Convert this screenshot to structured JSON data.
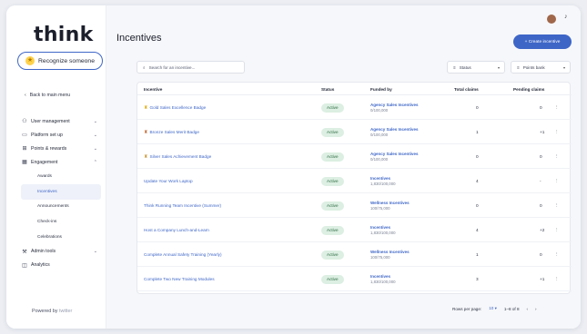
{
  "app": {
    "logo": "think",
    "page_title": "Incentives"
  },
  "sidebar": {
    "recognize_label": "Recognize someone",
    "back_label": "Back to main menu",
    "items": [
      {
        "label": "User management",
        "icon": "users-icon",
        "chevron": "v"
      },
      {
        "label": "Platform set up",
        "icon": "monitor-icon",
        "chevron": "v"
      },
      {
        "label": "Points & rewards",
        "icon": "gift-icon",
        "chevron": "v"
      },
      {
        "label": "Engagement",
        "icon": "calendar-icon",
        "chevron": "^"
      }
    ],
    "engagement_sub": [
      {
        "label": "Awards"
      },
      {
        "label": "Incentives"
      },
      {
        "label": "Announcements"
      },
      {
        "label": "Check-ins"
      },
      {
        "label": "Celebrations"
      }
    ],
    "items_after": [
      {
        "label": "Admin tools",
        "icon": "tools-icon",
        "chevron": "v"
      },
      {
        "label": "Analytics",
        "icon": "analytics-icon",
        "chevron": ""
      }
    ],
    "powered_by": "Powered by",
    "powered_brand": "twitter"
  },
  "header": {
    "create_label": "+ Create incentive"
  },
  "toolbar": {
    "search_placeholder": "Search for an incentive...",
    "status_filter": "Status",
    "points_filter": "Points bank"
  },
  "table": {
    "headers": [
      "Incentive",
      "Status",
      "Funded by",
      "Total claims",
      "Pending claims"
    ],
    "rows": [
      {
        "incentive": "Gold Sales Excellence Badge",
        "medal": "gold",
        "status": "Active",
        "fund_name": "Agency Sales Incentives",
        "fund_amount": "0/100,000",
        "total": "0",
        "pending": "0"
      },
      {
        "incentive": "Bronze Sales Merit Badge",
        "medal": "bronze",
        "status": "Active",
        "fund_name": "Agency Sales Incentives",
        "fund_amount": "0/100,000",
        "total": "1",
        "pending": "+1"
      },
      {
        "incentive": "Silver Sales Achievement Badge",
        "medal": "silver",
        "status": "Active",
        "fund_name": "Agency Sales Incentives",
        "fund_amount": "0/100,000",
        "total": "0",
        "pending": "0"
      },
      {
        "incentive": "Update Your Work Laptop",
        "medal": "",
        "status": "Active",
        "fund_name": "Incentives",
        "fund_amount": "1,830/100,000",
        "total": "4",
        "pending": "-"
      },
      {
        "incentive": "Think Running Team Incentive (Summer)",
        "medal": "",
        "status": "Active",
        "fund_name": "Wellness Incentives",
        "fund_amount": "100/75,000",
        "total": "0",
        "pending": "0"
      },
      {
        "incentive": "Host a Company Lunch-and-Learn",
        "medal": "",
        "status": "Active",
        "fund_name": "Incentives",
        "fund_amount": "1,830/100,000",
        "total": "4",
        "pending": "+2"
      },
      {
        "incentive": "Complete Annual Safety Training (Yearly)",
        "medal": "",
        "status": "Active",
        "fund_name": "Wellness Incentives",
        "fund_amount": "100/75,000",
        "total": "1",
        "pending": "0"
      },
      {
        "incentive": "Complete Two New Training Modules",
        "medal": "",
        "status": "Active",
        "fund_name": "Incentives",
        "fund_amount": "1,830/100,000",
        "total": "3",
        "pending": "+1"
      }
    ]
  },
  "pagination": {
    "rows_per_page_label": "Rows per page:",
    "rows_per_page": "10 ▾",
    "range": "1–8 of 8",
    "prev": "‹",
    "next": "›"
  },
  "colors": {
    "accent": "#3e66c7",
    "status_bg": "#dcefe2",
    "gold": "#e0a800",
    "bronze": "#c0642c",
    "silver": "#c8932d"
  }
}
